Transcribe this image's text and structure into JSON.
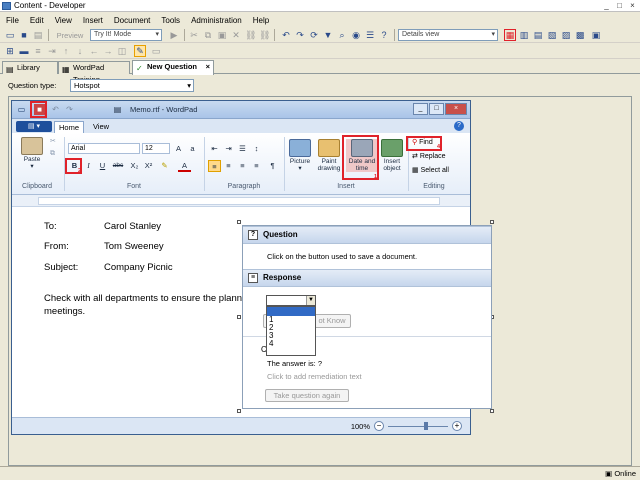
{
  "app": {
    "title": "Content - Developer",
    "window_buttons": [
      "_",
      "□",
      "×"
    ]
  },
  "menu": [
    "File",
    "Edit",
    "View",
    "Insert",
    "Document",
    "Tools",
    "Administration",
    "Help"
  ],
  "toolbar": {
    "preview_label": "Preview",
    "mode_value": "Try It! Mode",
    "view_value": "Details view"
  },
  "tabs": [
    {
      "label": "Library",
      "icon": "library-icon"
    },
    {
      "label": "WordPad Training",
      "icon": "document-icon"
    },
    {
      "label": "New Question",
      "icon": "checkmark-icon",
      "close": "×"
    }
  ],
  "question_type": {
    "label": "Question type:",
    "value": "Hotspot"
  },
  "wordpad": {
    "title": "Memo.rtf - WordPad",
    "ribbon_tabs": [
      "Home",
      "View"
    ],
    "groups": {
      "clipboard": "Clipboard",
      "font": "Font",
      "paragraph": "Paragraph",
      "insert": "Insert",
      "editing": "Editing"
    },
    "clipboard": {
      "paste": "Paste"
    },
    "font": {
      "family": "Arial",
      "size": "12",
      "bold": "B",
      "italic": "I",
      "underline": "U",
      "strike": "abc",
      "sub": "X₂",
      "sup": "X²"
    },
    "insert": {
      "picture": "Picture",
      "paint": "Paint drawing",
      "datetime": "Date and time",
      "object": "Insert object"
    },
    "editing": {
      "find": "Find",
      "replace": "Replace",
      "select_all": "Select all"
    },
    "memo": {
      "to_label": "To:",
      "to_value": "Carol Stanley",
      "from_label": "From:",
      "from_value": "Tom Sweeney",
      "subject_label": "Subject:",
      "subject_value": "Company Picnic",
      "body_line1": "Check with all departments to ensure the plann",
      "body_line2": "meetings."
    },
    "zoom": "100%",
    "hotspot_numbers": [
      "3",
      "2",
      "1",
      "4"
    ]
  },
  "question_panel": {
    "question_header": "Question",
    "question_text": "Click on the button used to save a document.",
    "response_header": "Response",
    "dropdown_options": [
      "",
      "1",
      "2",
      "3",
      "4"
    ],
    "hidden_button_fragment": "ot Know",
    "partial_text": "C",
    "answer_text": "The answer is: ?",
    "remediation_text": "Click to add remediation text",
    "take_again": "Take question again"
  },
  "status": {
    "online": "Online"
  },
  "colors": {
    "highlight": "#e0222a",
    "selection": "#316ac5"
  }
}
